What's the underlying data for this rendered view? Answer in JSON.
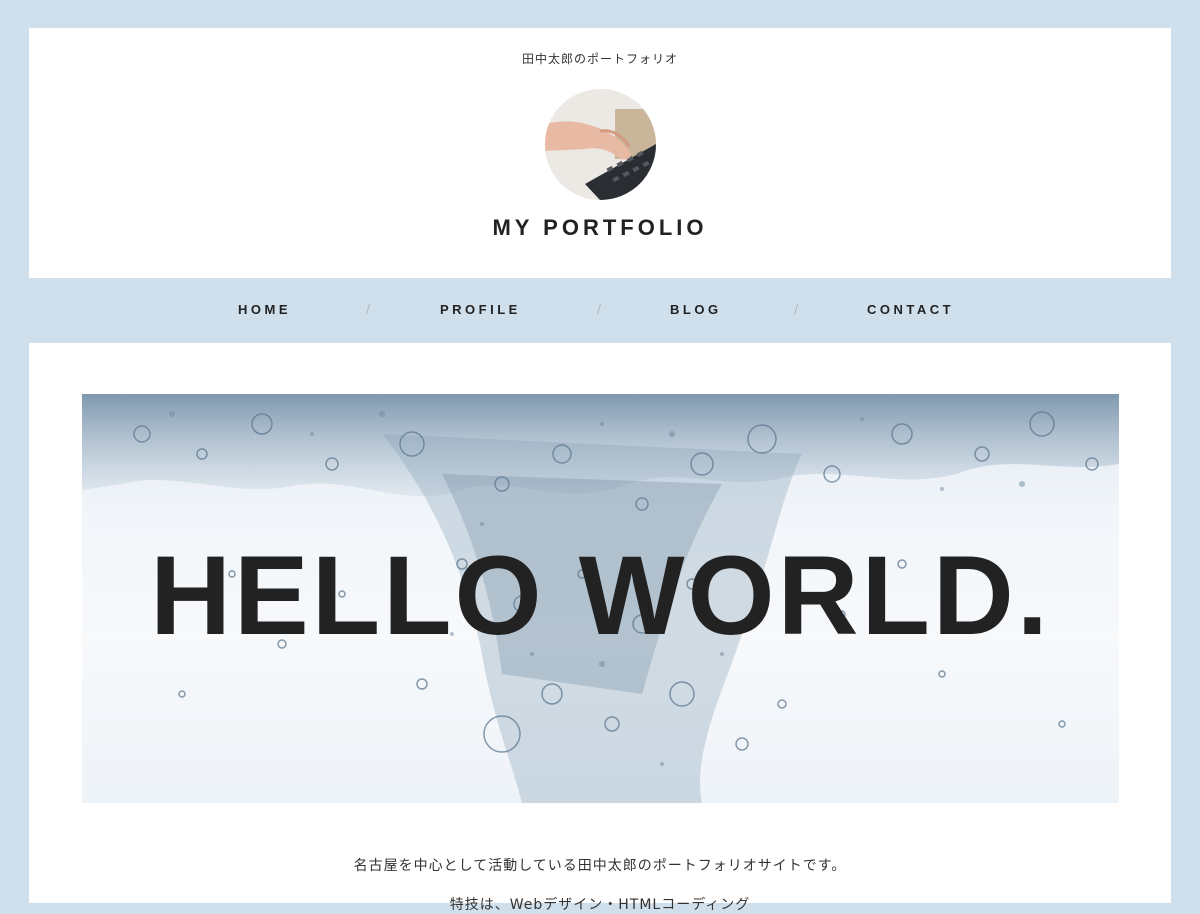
{
  "header": {
    "tagline": "田中太郎のポートフォリオ",
    "site_title": "MY PORTFOLIO",
    "avatar_icon": "hand-on-keyboard-photo"
  },
  "nav": {
    "items": [
      {
        "label": "HOME"
      },
      {
        "label": "PROFILE"
      },
      {
        "label": "BLOG"
      },
      {
        "label": "CONTACT"
      }
    ],
    "separator": "/"
  },
  "hero": {
    "title": "HELLO WORLD.",
    "image": "water-bubbles-photo"
  },
  "main": {
    "intro": "名古屋を中心として活動している田中太郎のポートフォリオサイトです。",
    "intro_2": "特技は、Webデザイン・HTMLコーディング"
  },
  "colors": {
    "background": "#cfe0ec",
    "card": "#ffffff",
    "text": "#222222"
  }
}
